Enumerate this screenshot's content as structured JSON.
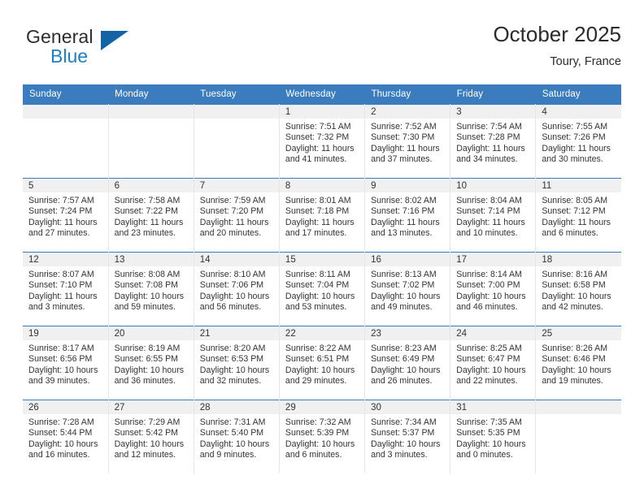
{
  "brand": {
    "name_top": "General",
    "name_bottom": "Blue",
    "accent_color": "#1464a5",
    "blue_text_color": "#1d7fc4"
  },
  "header": {
    "title": "October 2025",
    "subtitle": "Toury, France"
  },
  "theme": {
    "header_row_bg": "#3a7cbd",
    "daynum_band_bg": "#f0f0f0",
    "cell_border": "#e6e6e6",
    "text_color": "#333333"
  },
  "weekdays": [
    "Sunday",
    "Monday",
    "Tuesday",
    "Wednesday",
    "Thursday",
    "Friday",
    "Saturday"
  ],
  "weeks": [
    [
      {
        "day": "",
        "empty": true
      },
      {
        "day": "",
        "empty": true
      },
      {
        "day": "",
        "empty": true
      },
      {
        "day": "1",
        "sunrise": "Sunrise: 7:51 AM",
        "sunset": "Sunset: 7:32 PM",
        "daylight1": "Daylight: 11 hours",
        "daylight2": "and 41 minutes."
      },
      {
        "day": "2",
        "sunrise": "Sunrise: 7:52 AM",
        "sunset": "Sunset: 7:30 PM",
        "daylight1": "Daylight: 11 hours",
        "daylight2": "and 37 minutes."
      },
      {
        "day": "3",
        "sunrise": "Sunrise: 7:54 AM",
        "sunset": "Sunset: 7:28 PM",
        "daylight1": "Daylight: 11 hours",
        "daylight2": "and 34 minutes."
      },
      {
        "day": "4",
        "sunrise": "Sunrise: 7:55 AM",
        "sunset": "Sunset: 7:26 PM",
        "daylight1": "Daylight: 11 hours",
        "daylight2": "and 30 minutes."
      }
    ],
    [
      {
        "day": "5",
        "sunrise": "Sunrise: 7:57 AM",
        "sunset": "Sunset: 7:24 PM",
        "daylight1": "Daylight: 11 hours",
        "daylight2": "and 27 minutes."
      },
      {
        "day": "6",
        "sunrise": "Sunrise: 7:58 AM",
        "sunset": "Sunset: 7:22 PM",
        "daylight1": "Daylight: 11 hours",
        "daylight2": "and 23 minutes."
      },
      {
        "day": "7",
        "sunrise": "Sunrise: 7:59 AM",
        "sunset": "Sunset: 7:20 PM",
        "daylight1": "Daylight: 11 hours",
        "daylight2": "and 20 minutes."
      },
      {
        "day": "8",
        "sunrise": "Sunrise: 8:01 AM",
        "sunset": "Sunset: 7:18 PM",
        "daylight1": "Daylight: 11 hours",
        "daylight2": "and 17 minutes."
      },
      {
        "day": "9",
        "sunrise": "Sunrise: 8:02 AM",
        "sunset": "Sunset: 7:16 PM",
        "daylight1": "Daylight: 11 hours",
        "daylight2": "and 13 minutes."
      },
      {
        "day": "10",
        "sunrise": "Sunrise: 8:04 AM",
        "sunset": "Sunset: 7:14 PM",
        "daylight1": "Daylight: 11 hours",
        "daylight2": "and 10 minutes."
      },
      {
        "day": "11",
        "sunrise": "Sunrise: 8:05 AM",
        "sunset": "Sunset: 7:12 PM",
        "daylight1": "Daylight: 11 hours",
        "daylight2": "and 6 minutes."
      }
    ],
    [
      {
        "day": "12",
        "sunrise": "Sunrise: 8:07 AM",
        "sunset": "Sunset: 7:10 PM",
        "daylight1": "Daylight: 11 hours",
        "daylight2": "and 3 minutes."
      },
      {
        "day": "13",
        "sunrise": "Sunrise: 8:08 AM",
        "sunset": "Sunset: 7:08 PM",
        "daylight1": "Daylight: 10 hours",
        "daylight2": "and 59 minutes."
      },
      {
        "day": "14",
        "sunrise": "Sunrise: 8:10 AM",
        "sunset": "Sunset: 7:06 PM",
        "daylight1": "Daylight: 10 hours",
        "daylight2": "and 56 minutes."
      },
      {
        "day": "15",
        "sunrise": "Sunrise: 8:11 AM",
        "sunset": "Sunset: 7:04 PM",
        "daylight1": "Daylight: 10 hours",
        "daylight2": "and 53 minutes."
      },
      {
        "day": "16",
        "sunrise": "Sunrise: 8:13 AM",
        "sunset": "Sunset: 7:02 PM",
        "daylight1": "Daylight: 10 hours",
        "daylight2": "and 49 minutes."
      },
      {
        "day": "17",
        "sunrise": "Sunrise: 8:14 AM",
        "sunset": "Sunset: 7:00 PM",
        "daylight1": "Daylight: 10 hours",
        "daylight2": "and 46 minutes."
      },
      {
        "day": "18",
        "sunrise": "Sunrise: 8:16 AM",
        "sunset": "Sunset: 6:58 PM",
        "daylight1": "Daylight: 10 hours",
        "daylight2": "and 42 minutes."
      }
    ],
    [
      {
        "day": "19",
        "sunrise": "Sunrise: 8:17 AM",
        "sunset": "Sunset: 6:56 PM",
        "daylight1": "Daylight: 10 hours",
        "daylight2": "and 39 minutes."
      },
      {
        "day": "20",
        "sunrise": "Sunrise: 8:19 AM",
        "sunset": "Sunset: 6:55 PM",
        "daylight1": "Daylight: 10 hours",
        "daylight2": "and 36 minutes."
      },
      {
        "day": "21",
        "sunrise": "Sunrise: 8:20 AM",
        "sunset": "Sunset: 6:53 PM",
        "daylight1": "Daylight: 10 hours",
        "daylight2": "and 32 minutes."
      },
      {
        "day": "22",
        "sunrise": "Sunrise: 8:22 AM",
        "sunset": "Sunset: 6:51 PM",
        "daylight1": "Daylight: 10 hours",
        "daylight2": "and 29 minutes."
      },
      {
        "day": "23",
        "sunrise": "Sunrise: 8:23 AM",
        "sunset": "Sunset: 6:49 PM",
        "daylight1": "Daylight: 10 hours",
        "daylight2": "and 26 minutes."
      },
      {
        "day": "24",
        "sunrise": "Sunrise: 8:25 AM",
        "sunset": "Sunset: 6:47 PM",
        "daylight1": "Daylight: 10 hours",
        "daylight2": "and 22 minutes."
      },
      {
        "day": "25",
        "sunrise": "Sunrise: 8:26 AM",
        "sunset": "Sunset: 6:46 PM",
        "daylight1": "Daylight: 10 hours",
        "daylight2": "and 19 minutes."
      }
    ],
    [
      {
        "day": "26",
        "sunrise": "Sunrise: 7:28 AM",
        "sunset": "Sunset: 5:44 PM",
        "daylight1": "Daylight: 10 hours",
        "daylight2": "and 16 minutes."
      },
      {
        "day": "27",
        "sunrise": "Sunrise: 7:29 AM",
        "sunset": "Sunset: 5:42 PM",
        "daylight1": "Daylight: 10 hours",
        "daylight2": "and 12 minutes."
      },
      {
        "day": "28",
        "sunrise": "Sunrise: 7:31 AM",
        "sunset": "Sunset: 5:40 PM",
        "daylight1": "Daylight: 10 hours",
        "daylight2": "and 9 minutes."
      },
      {
        "day": "29",
        "sunrise": "Sunrise: 7:32 AM",
        "sunset": "Sunset: 5:39 PM",
        "daylight1": "Daylight: 10 hours",
        "daylight2": "and 6 minutes."
      },
      {
        "day": "30",
        "sunrise": "Sunrise: 7:34 AM",
        "sunset": "Sunset: 5:37 PM",
        "daylight1": "Daylight: 10 hours",
        "daylight2": "and 3 minutes."
      },
      {
        "day": "31",
        "sunrise": "Sunrise: 7:35 AM",
        "sunset": "Sunset: 5:35 PM",
        "daylight1": "Daylight: 10 hours",
        "daylight2": "and 0 minutes."
      },
      {
        "day": "",
        "empty": true
      }
    ]
  ]
}
